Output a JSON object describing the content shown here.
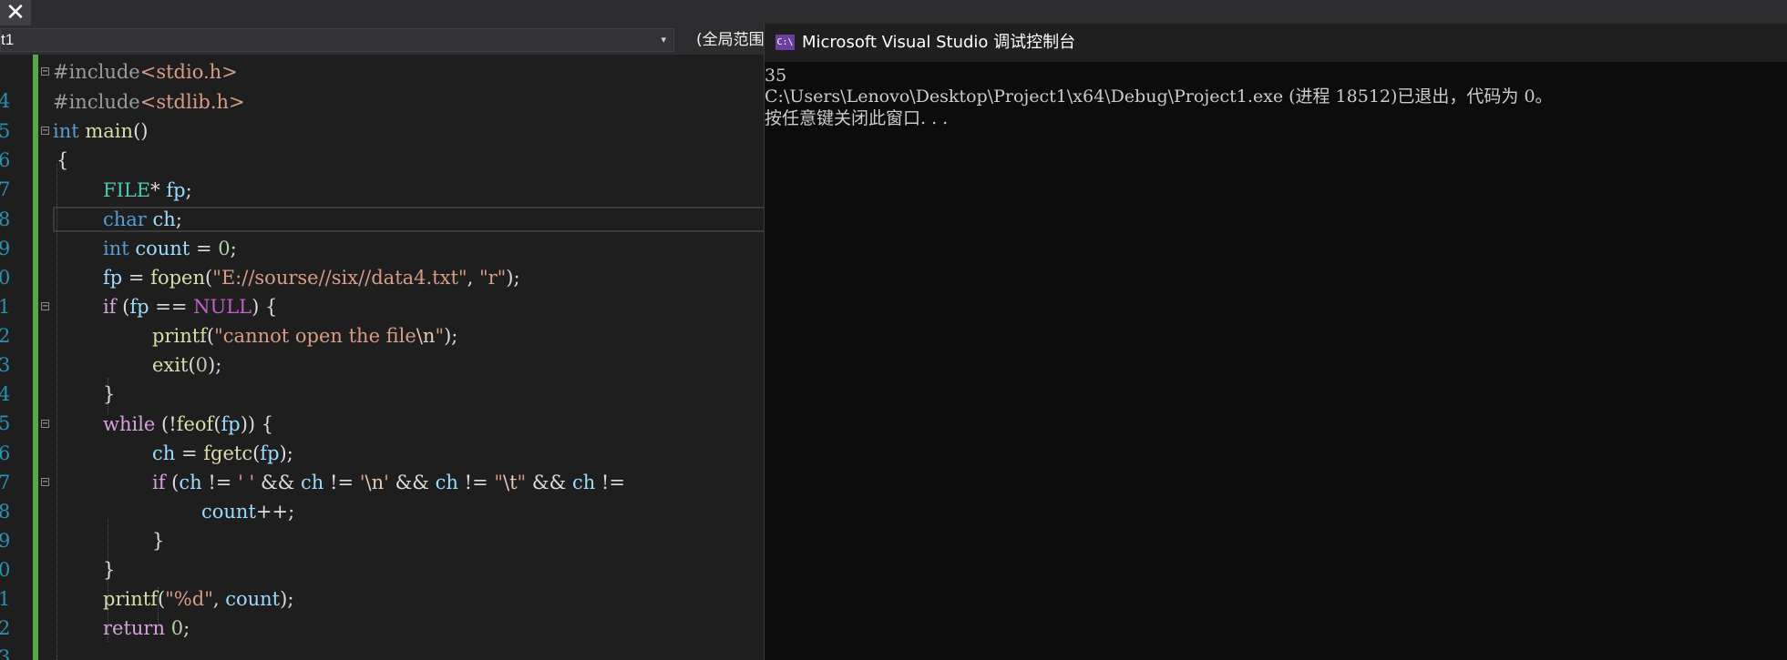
{
  "tabs": {
    "close_glyph": "✕"
  },
  "navbar": {
    "project_dropdown": "t1",
    "project_dropdown_arrow": "▾",
    "scope_dropdown": "(全局范围)"
  },
  "editor": {
    "line_numbers": [
      "4",
      "5",
      "6",
      "7",
      "8",
      "9",
      "0",
      "1",
      "2",
      "3",
      "4",
      "5",
      "6",
      "7",
      "8",
      "9",
      "0",
      "1",
      "2",
      "3"
    ]
  },
  "console": {
    "icon_text": "C:\\",
    "title": "Microsoft Visual Studio 调试控制台",
    "output_lines": [
      "35",
      "C:\\Users\\Lenovo\\Desktop\\Project1\\x64\\Debug\\Project1.exe (进程 18512)已退出，代码为 0。",
      "按任意键关闭此窗口. . ."
    ]
  },
  "colors": {
    "editor_bg": "#1e1e1e",
    "keyword": "#569cd6",
    "control": "#d8a0df",
    "type": "#4ec9b0",
    "function": "#dcdcaa",
    "variable": "#9cdcfe",
    "string": "#d69d85",
    "number": "#b5cea8",
    "line_number": "#2b91af",
    "changed_bar": "#57a64a",
    "console_bg": "#0c0c0c"
  },
  "icons": [
    "close-icon",
    "dropdown-arrow-icon",
    "fold-icon",
    "console-app-icon"
  ]
}
